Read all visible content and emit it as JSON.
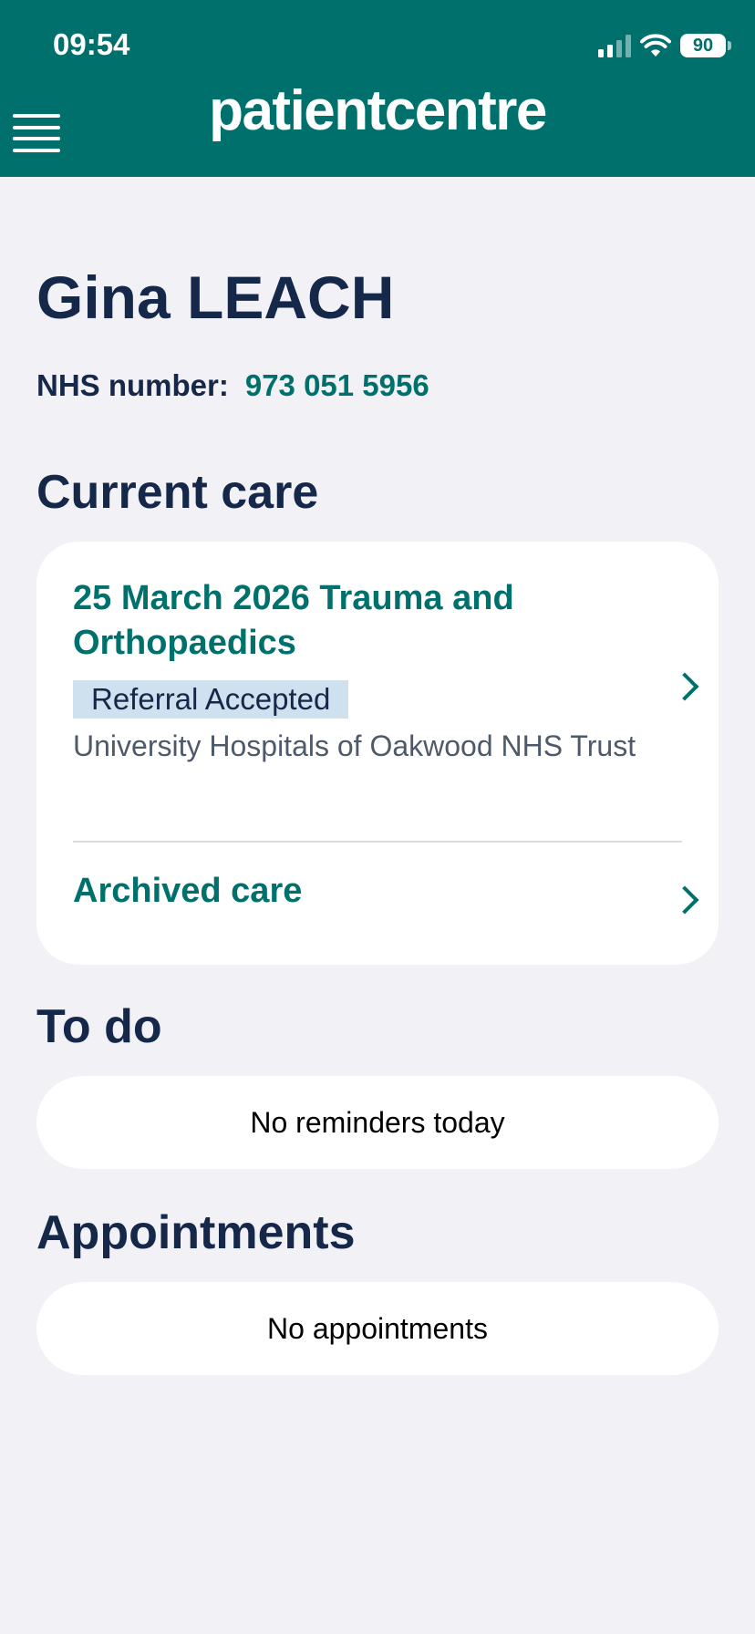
{
  "status_bar": {
    "time": "09:54",
    "battery": "90"
  },
  "header": {
    "app_name": "patientcentre",
    "menu_icon": "hamburger-menu-icon"
  },
  "patient": {
    "name": "Gina LEACH",
    "nhs_label": "NHS number:",
    "nhs_number": "973 051 5956"
  },
  "current_care": {
    "heading": "Current care",
    "items": [
      {
        "title": "25 March 2026 Trauma and Orthopaedics",
        "status": "Referral Accepted",
        "trust": "University Hospitals of Oakwood NHS Trust"
      }
    ],
    "archived_label": "Archived care"
  },
  "todo": {
    "heading": "To do",
    "empty_text": "No reminders today"
  },
  "appointments": {
    "heading": "Appointments",
    "empty_text": "No appointments"
  },
  "colors": {
    "brand": "#00706c",
    "heading": "#152849",
    "background": "#f1f1f6",
    "badge": "#cfe0ef"
  }
}
